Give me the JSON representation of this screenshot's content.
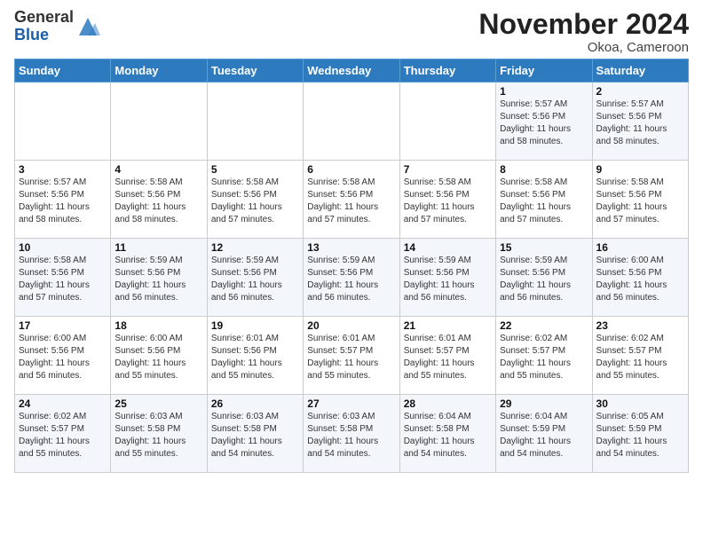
{
  "logo": {
    "general": "General",
    "blue": "Blue"
  },
  "header": {
    "month": "November 2024",
    "location": "Okoa, Cameroon"
  },
  "days_of_week": [
    "Sunday",
    "Monday",
    "Tuesday",
    "Wednesday",
    "Thursday",
    "Friday",
    "Saturday"
  ],
  "weeks": [
    [
      {
        "day": "",
        "info": ""
      },
      {
        "day": "",
        "info": ""
      },
      {
        "day": "",
        "info": ""
      },
      {
        "day": "",
        "info": ""
      },
      {
        "day": "",
        "info": ""
      },
      {
        "day": "1",
        "info": "Sunrise: 5:57 AM\nSunset: 5:56 PM\nDaylight: 11 hours\nand 58 minutes."
      },
      {
        "day": "2",
        "info": "Sunrise: 5:57 AM\nSunset: 5:56 PM\nDaylight: 11 hours\nand 58 minutes."
      }
    ],
    [
      {
        "day": "3",
        "info": "Sunrise: 5:57 AM\nSunset: 5:56 PM\nDaylight: 11 hours\nand 58 minutes."
      },
      {
        "day": "4",
        "info": "Sunrise: 5:58 AM\nSunset: 5:56 PM\nDaylight: 11 hours\nand 58 minutes."
      },
      {
        "day": "5",
        "info": "Sunrise: 5:58 AM\nSunset: 5:56 PM\nDaylight: 11 hours\nand 57 minutes."
      },
      {
        "day": "6",
        "info": "Sunrise: 5:58 AM\nSunset: 5:56 PM\nDaylight: 11 hours\nand 57 minutes."
      },
      {
        "day": "7",
        "info": "Sunrise: 5:58 AM\nSunset: 5:56 PM\nDaylight: 11 hours\nand 57 minutes."
      },
      {
        "day": "8",
        "info": "Sunrise: 5:58 AM\nSunset: 5:56 PM\nDaylight: 11 hours\nand 57 minutes."
      },
      {
        "day": "9",
        "info": "Sunrise: 5:58 AM\nSunset: 5:56 PM\nDaylight: 11 hours\nand 57 minutes."
      }
    ],
    [
      {
        "day": "10",
        "info": "Sunrise: 5:58 AM\nSunset: 5:56 PM\nDaylight: 11 hours\nand 57 minutes."
      },
      {
        "day": "11",
        "info": "Sunrise: 5:59 AM\nSunset: 5:56 PM\nDaylight: 11 hours\nand 56 minutes."
      },
      {
        "day": "12",
        "info": "Sunrise: 5:59 AM\nSunset: 5:56 PM\nDaylight: 11 hours\nand 56 minutes."
      },
      {
        "day": "13",
        "info": "Sunrise: 5:59 AM\nSunset: 5:56 PM\nDaylight: 11 hours\nand 56 minutes."
      },
      {
        "day": "14",
        "info": "Sunrise: 5:59 AM\nSunset: 5:56 PM\nDaylight: 11 hours\nand 56 minutes."
      },
      {
        "day": "15",
        "info": "Sunrise: 5:59 AM\nSunset: 5:56 PM\nDaylight: 11 hours\nand 56 minutes."
      },
      {
        "day": "16",
        "info": "Sunrise: 6:00 AM\nSunset: 5:56 PM\nDaylight: 11 hours\nand 56 minutes."
      }
    ],
    [
      {
        "day": "17",
        "info": "Sunrise: 6:00 AM\nSunset: 5:56 PM\nDaylight: 11 hours\nand 56 minutes."
      },
      {
        "day": "18",
        "info": "Sunrise: 6:00 AM\nSunset: 5:56 PM\nDaylight: 11 hours\nand 55 minutes."
      },
      {
        "day": "19",
        "info": "Sunrise: 6:01 AM\nSunset: 5:56 PM\nDaylight: 11 hours\nand 55 minutes."
      },
      {
        "day": "20",
        "info": "Sunrise: 6:01 AM\nSunset: 5:57 PM\nDaylight: 11 hours\nand 55 minutes."
      },
      {
        "day": "21",
        "info": "Sunrise: 6:01 AM\nSunset: 5:57 PM\nDaylight: 11 hours\nand 55 minutes."
      },
      {
        "day": "22",
        "info": "Sunrise: 6:02 AM\nSunset: 5:57 PM\nDaylight: 11 hours\nand 55 minutes."
      },
      {
        "day": "23",
        "info": "Sunrise: 6:02 AM\nSunset: 5:57 PM\nDaylight: 11 hours\nand 55 minutes."
      }
    ],
    [
      {
        "day": "24",
        "info": "Sunrise: 6:02 AM\nSunset: 5:57 PM\nDaylight: 11 hours\nand 55 minutes."
      },
      {
        "day": "25",
        "info": "Sunrise: 6:03 AM\nSunset: 5:58 PM\nDaylight: 11 hours\nand 55 minutes."
      },
      {
        "day": "26",
        "info": "Sunrise: 6:03 AM\nSunset: 5:58 PM\nDaylight: 11 hours\nand 54 minutes."
      },
      {
        "day": "27",
        "info": "Sunrise: 6:03 AM\nSunset: 5:58 PM\nDaylight: 11 hours\nand 54 minutes."
      },
      {
        "day": "28",
        "info": "Sunrise: 6:04 AM\nSunset: 5:58 PM\nDaylight: 11 hours\nand 54 minutes."
      },
      {
        "day": "29",
        "info": "Sunrise: 6:04 AM\nSunset: 5:59 PM\nDaylight: 11 hours\nand 54 minutes."
      },
      {
        "day": "30",
        "info": "Sunrise: 6:05 AM\nSunset: 5:59 PM\nDaylight: 11 hours\nand 54 minutes."
      }
    ]
  ]
}
